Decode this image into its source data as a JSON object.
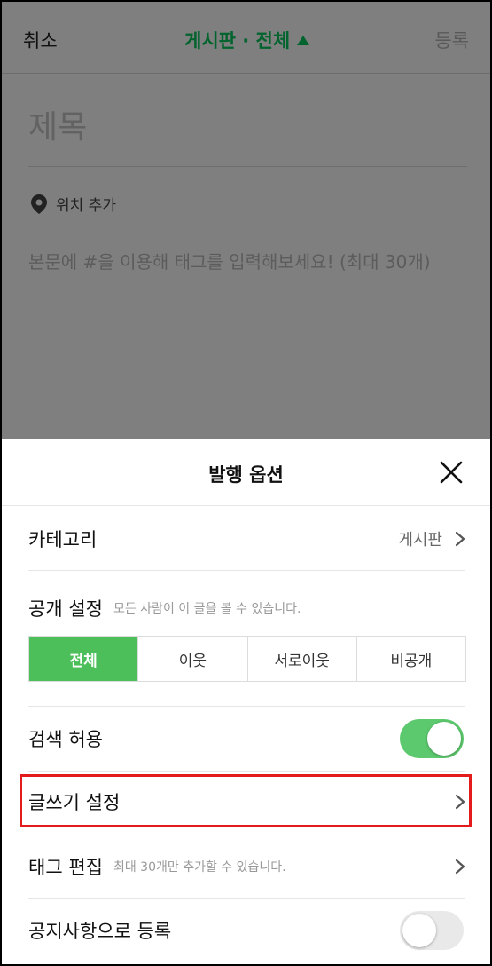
{
  "editor": {
    "cancel_label": "취소",
    "board_title": "게시판 · 전체",
    "register_label": "등록",
    "title_placeholder": "제목",
    "location_label": "위치 추가",
    "body_placeholder": "본문에 #을 이용해 태그를 입력해보세요! (최대 30개)"
  },
  "sheet": {
    "title": "발행 옵션",
    "category": {
      "label": "카테고리",
      "value": "게시판"
    },
    "visibility": {
      "label": "공개 설정",
      "sub": "모든 사람이 이 글을 볼 수 있습니다.",
      "options": [
        "전체",
        "이웃",
        "서로이웃",
        "비공개"
      ],
      "selected": "전체"
    },
    "search": {
      "label": "검색 허용",
      "enabled": true
    },
    "writing": {
      "label": "글쓰기 설정"
    },
    "tags": {
      "label": "태그 편집",
      "sub": "최대 30개만 추가할 수 있습니다."
    },
    "notice": {
      "label": "공지사항으로 등록",
      "enabled": false
    }
  },
  "colors": {
    "accent": "#03c75a",
    "segment_active": "#4cbf5a",
    "toggle_on": "#5cc96e",
    "highlight": "#e41b1b"
  }
}
